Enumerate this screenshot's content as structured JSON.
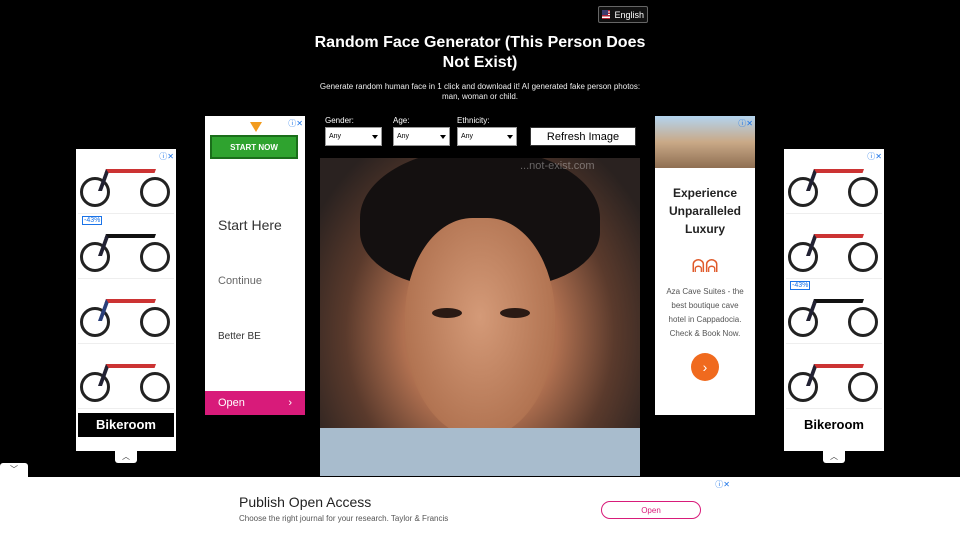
{
  "language": {
    "label": "English",
    "icon": "us-flag-icon"
  },
  "header": {
    "title": "Random Face Generator (This Person Does Not Exist)",
    "subtitle": "Generate random human face in 1 click and download it! AI generated fake person photos: man, woman or child."
  },
  "controls": {
    "gender": {
      "label": "Gender:",
      "value": "Any"
    },
    "age": {
      "label": "Age:",
      "value": "Any"
    },
    "ethnicity": {
      "label": "Ethnicity:",
      "value": "Any"
    },
    "refresh_label": "Refresh Image"
  },
  "photo": {
    "watermark": "...not-exist.com"
  },
  "left_ad": {
    "badge": "-43%",
    "brand": "Bikeroom"
  },
  "left_ad2": {
    "start_label": "START NOW",
    "link1": "Start Here",
    "link2": "Continue",
    "link3": "Better BE",
    "open_label": "Open"
  },
  "right_ad1": {
    "title": "Experience Unparalleled Luxury",
    "logo": "ꟺꟻ",
    "text": "Aza Cave Suites - the best boutique cave hotel in Cappadocia. Check & Book Now."
  },
  "right_ad2": {
    "badge": "-43%",
    "brand": "Bikeroom"
  },
  "bottom_ad": {
    "headline": "Publish Open Access",
    "sub": "Choose the right journal for your research. Taylor & Francis",
    "button": "Open"
  },
  "colors": {
    "bg": "#000000",
    "open_pink": "#d81b7a",
    "start_green": "#2fa32f",
    "hotel_orange": "#f06a1e"
  }
}
